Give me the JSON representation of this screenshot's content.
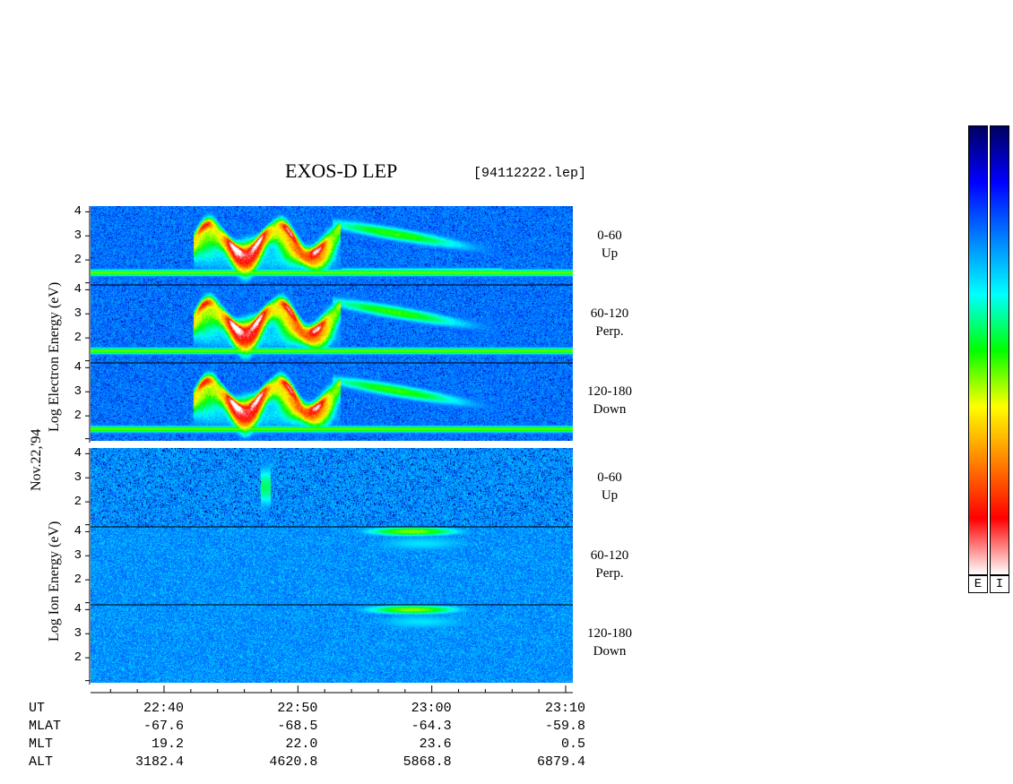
{
  "header": {
    "title": "EXOS-D LEP",
    "filename": "[94112222.lep]"
  },
  "date_label": "Nov.22,'94",
  "chart_data": {
    "type": "heatmap",
    "title": "EXOS-D LEP",
    "groups": [
      {
        "name": "Electron",
        "ylabel": "Log   Electron   Energy (eV)",
        "panels": [
          {
            "angle": "0-60",
            "direction": "Up",
            "yticks": [
              "4",
              "3",
              "2"
            ]
          },
          {
            "angle": "60-120",
            "direction": "Perp.",
            "yticks": [
              "4",
              "3",
              "2"
            ]
          },
          {
            "angle": "120-180",
            "direction": "Down",
            "yticks": [
              "4",
              "3",
              "2"
            ]
          }
        ]
      },
      {
        "name": "Ion",
        "ylabel": "Log   Ion   Energy (eV)",
        "panels": [
          {
            "angle": "0-60",
            "direction": "Up",
            "yticks": [
              "4",
              "3",
              "2"
            ]
          },
          {
            "angle": "60-120",
            "direction": "Perp.",
            "yticks": [
              "4",
              "3",
              "2"
            ]
          },
          {
            "angle": "120-180",
            "direction": "Down",
            "yticks": [
              "4",
              "3",
              "2"
            ]
          }
        ]
      }
    ],
    "ylim": [
      1,
      4.2
    ],
    "x_axis": {
      "rows": [
        {
          "label": "UT",
          "values": [
            "22:40",
            "22:50",
            "23:00",
            "23:10"
          ]
        },
        {
          "label": "MLAT",
          "values": [
            "-67.6",
            "-68.5",
            "-64.3",
            "-59.8"
          ]
        },
        {
          "label": "MLT",
          "values": [
            "19.2",
            "22.0",
            "23.6",
            "0.5"
          ]
        },
        {
          "label": "ALT",
          "values": [
            "3182.4",
            "4620.8",
            "5868.8",
            "6879.4"
          ]
        }
      ]
    },
    "colorbars": [
      {
        "label": "E"
      },
      {
        "label": "I"
      }
    ],
    "colormap": [
      "#ffffff",
      "#ff0000",
      "#ff8000",
      "#ffff00",
      "#00ff00",
      "#00ffff",
      "#0080ff",
      "#0000ff",
      "#000060"
    ]
  }
}
